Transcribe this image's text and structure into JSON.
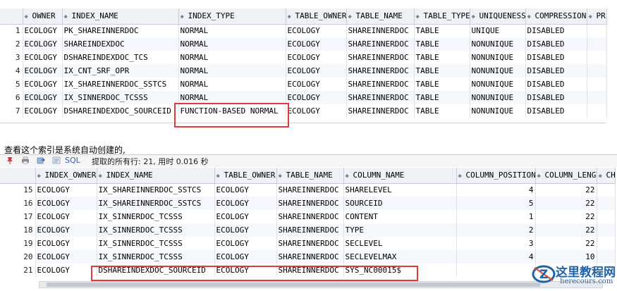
{
  "top_grid": {
    "columns": [
      "OWNER",
      "INDEX_NAME",
      "INDEX_TYPE",
      "TABLE_OWNER",
      "TABLE_NAME",
      "TABLE_TYPE",
      "UNIQUENESS",
      "COMPRESSION",
      "PR"
    ],
    "rows": [
      {
        "n": "1",
        "cells": [
          "ECOLOGY",
          "PK_SHAREINNERDOC",
          "NORMAL",
          "ECOLOGY",
          "SHAREINNERDOC",
          "TABLE",
          "UNIQUE",
          "DISABLED",
          ""
        ]
      },
      {
        "n": "2",
        "cells": [
          "ECOLOGY",
          "SHAREINDEXDOC",
          "NORMAL",
          "ECOLOGY",
          "SHAREINNERDOC",
          "TABLE",
          "NONUNIQUE",
          "DISABLED",
          ""
        ]
      },
      {
        "n": "3",
        "cells": [
          "ECOLOGY",
          "DSHAREINDEXDOC_TCS",
          "NORMAL",
          "ECOLOGY",
          "SHAREINNERDOC",
          "TABLE",
          "NONUNIQUE",
          "DISABLED",
          ""
        ]
      },
      {
        "n": "4",
        "cells": [
          "ECOLOGY",
          "IX_CNT_SRF_OPR",
          "NORMAL",
          "ECOLOGY",
          "SHAREINNERDOC",
          "TABLE",
          "NONUNIQUE",
          "DISABLED",
          ""
        ]
      },
      {
        "n": "5",
        "cells": [
          "ECOLOGY",
          "IX_SHAREINNERDOC_SSTCS",
          "NORMAL",
          "ECOLOGY",
          "SHAREINNERDOC",
          "TABLE",
          "NONUNIQUE",
          "DISABLED",
          ""
        ]
      },
      {
        "n": "6",
        "cells": [
          "ECOLOGY",
          "IX_SINNERDOC_TCSSS",
          "NORMAL",
          "ECOLOGY",
          "SHAREINNERDOC",
          "TABLE",
          "NONUNIQUE",
          "DISABLED",
          ""
        ]
      },
      {
        "n": "7",
        "cells": [
          "ECOLOGY",
          "DSHAREINDEXDOC_SOURCEID",
          "FUNCTION-BASED NORMAL",
          "ECOLOGY",
          "SHAREINNERDOC",
          "TABLE",
          "NONUNIQUE",
          "DISABLED",
          ""
        ]
      }
    ]
  },
  "caption": "查看这个索引是系统自动创建的,",
  "toolbar": {
    "sql_label": "SQL",
    "status": "提取的所有行: 21, 用时 0.016 秒"
  },
  "bottom_grid": {
    "columns": [
      "INDEX_OWNER",
      "INDEX_NAME",
      "TABLE_OWNER",
      "TABLE_NAME",
      "COLUMN_NAME",
      "COLUMN_POSITION",
      "COLUMN_LENGTH",
      "CH"
    ],
    "rows": [
      {
        "n": "15",
        "cells": [
          "ECOLOGY",
          "IX_SHAREINNERDOC_SSTCS",
          "ECOLOGY",
          "SHAREINNERDOC",
          "SHARELEVEL",
          "4",
          "22",
          ""
        ]
      },
      {
        "n": "16",
        "cells": [
          "ECOLOGY",
          "IX_SHAREINNERDOC_SSTCS",
          "ECOLOGY",
          "SHAREINNERDOC",
          "SOURCEID",
          "5",
          "22",
          ""
        ]
      },
      {
        "n": "17",
        "cells": [
          "ECOLOGY",
          "IX_SINNERDOC_TCSSS",
          "ECOLOGY",
          "SHAREINNERDOC",
          "CONTENT",
          "1",
          "22",
          ""
        ]
      },
      {
        "n": "18",
        "cells": [
          "ECOLOGY",
          "IX_SINNERDOC_TCSSS",
          "ECOLOGY",
          "SHAREINNERDOC",
          "TYPE",
          "2",
          "22",
          ""
        ]
      },
      {
        "n": "19",
        "cells": [
          "ECOLOGY",
          "IX_SINNERDOC_TCSSS",
          "ECOLOGY",
          "SHAREINNERDOC",
          "SECLEVEL",
          "3",
          "22",
          ""
        ]
      },
      {
        "n": "20",
        "cells": [
          "ECOLOGY",
          "IX_SINNERDOC_TCSSS",
          "ECOLOGY",
          "SHAREINNERDOC",
          "SECLEVELMAX",
          "4",
          "10",
          ""
        ]
      },
      {
        "n": "21",
        "cells": [
          "ECOLOGY",
          "DSHAREINDEXDOC_SOURCEID",
          "ECOLOGY",
          "SHAREINNERDOC",
          "SYS_NC00015$",
          "",
          "",
          ""
        ]
      }
    ]
  },
  "watermark": {
    "logo_letter": "Z",
    "title": "这里教程网",
    "domain": "herecours.com"
  },
  "colors": {
    "highlight": "#e03a3a",
    "header_bg": "#eef1f6",
    "watermark": "#1f62a8"
  }
}
